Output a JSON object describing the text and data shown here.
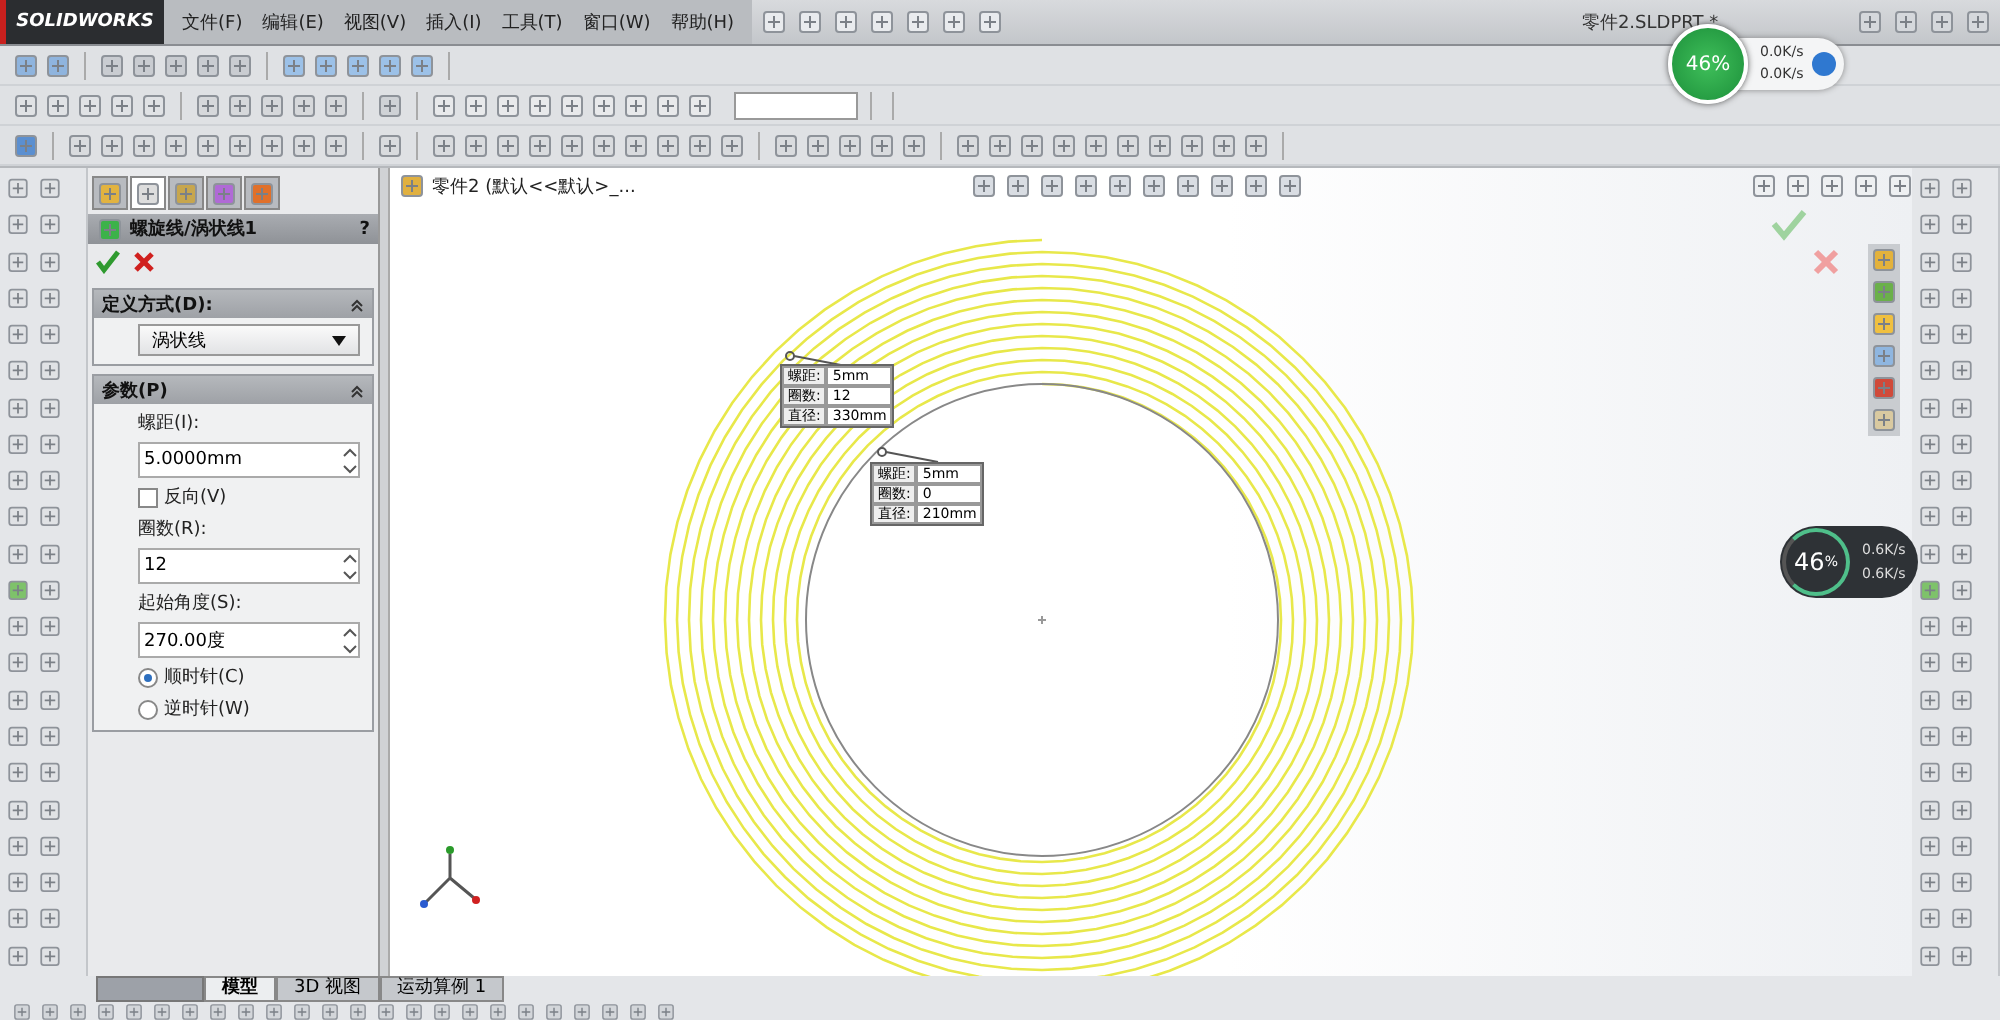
{
  "logo": "SOLIDWORKS",
  "menu": [
    "文件(F)",
    "编辑(E)",
    "视图(V)",
    "插入(I)",
    "工具(T)",
    "窗口(W)",
    "帮助(H)"
  ],
  "document_title": "零件2.SLDPRT *",
  "net_widget": {
    "percent": "46%",
    "upload": "0.0K/s",
    "download": "0.0K/s"
  },
  "property_manager": {
    "tabs": [
      {
        "selected": false
      },
      {
        "selected": true
      },
      {
        "selected": false
      },
      {
        "selected": false
      },
      {
        "selected": false
      }
    ],
    "title": "螺旋线/涡状线1",
    "help": "?",
    "sections": [
      {
        "title": "定义方式(D):",
        "items": [
          {
            "kind": "dropdown",
            "value": "涡状线"
          }
        ]
      },
      {
        "title": "参数(P)",
        "items": [
          {
            "kind": "spinner",
            "label": "螺距(I):",
            "value": "5.0000mm"
          },
          {
            "kind": "checkbox",
            "label": "反向(V)",
            "checked": false
          },
          {
            "kind": "spinner",
            "label": "圈数(R):",
            "value": "12"
          },
          {
            "kind": "spinner",
            "label": "起始角度(S):",
            "value": "270.00度"
          },
          {
            "kind": "radio",
            "label": "顺时针(C)",
            "selected": true
          },
          {
            "kind": "radio",
            "label": "逆时针(W)",
            "selected": false
          }
        ]
      }
    ]
  },
  "feature_tree": {
    "root": "零件2 (默认<<默认>_..."
  },
  "annotations": [
    {
      "rows": [
        {
          "label": "螺距:",
          "value": "5mm"
        },
        {
          "label": "圈数:",
          "value": "12"
        },
        {
          "label": "直径:",
          "value": "330mm"
        }
      ]
    },
    {
      "rows": [
        {
          "label": "螺距:",
          "value": "5mm"
        },
        {
          "label": "圈数:",
          "value": "0"
        },
        {
          "label": "直径:",
          "value": "210mm"
        }
      ]
    }
  ],
  "bottom_tabs": [
    {
      "label": "模型",
      "selected": true
    },
    {
      "label": "3D 视图",
      "selected": false
    },
    {
      "label": "运动算例 1",
      "selected": false
    }
  ],
  "speed_widget": {
    "percent": "46",
    "unit": "%",
    "upload": "0.6K/s",
    "download": "0.6K/s"
  }
}
